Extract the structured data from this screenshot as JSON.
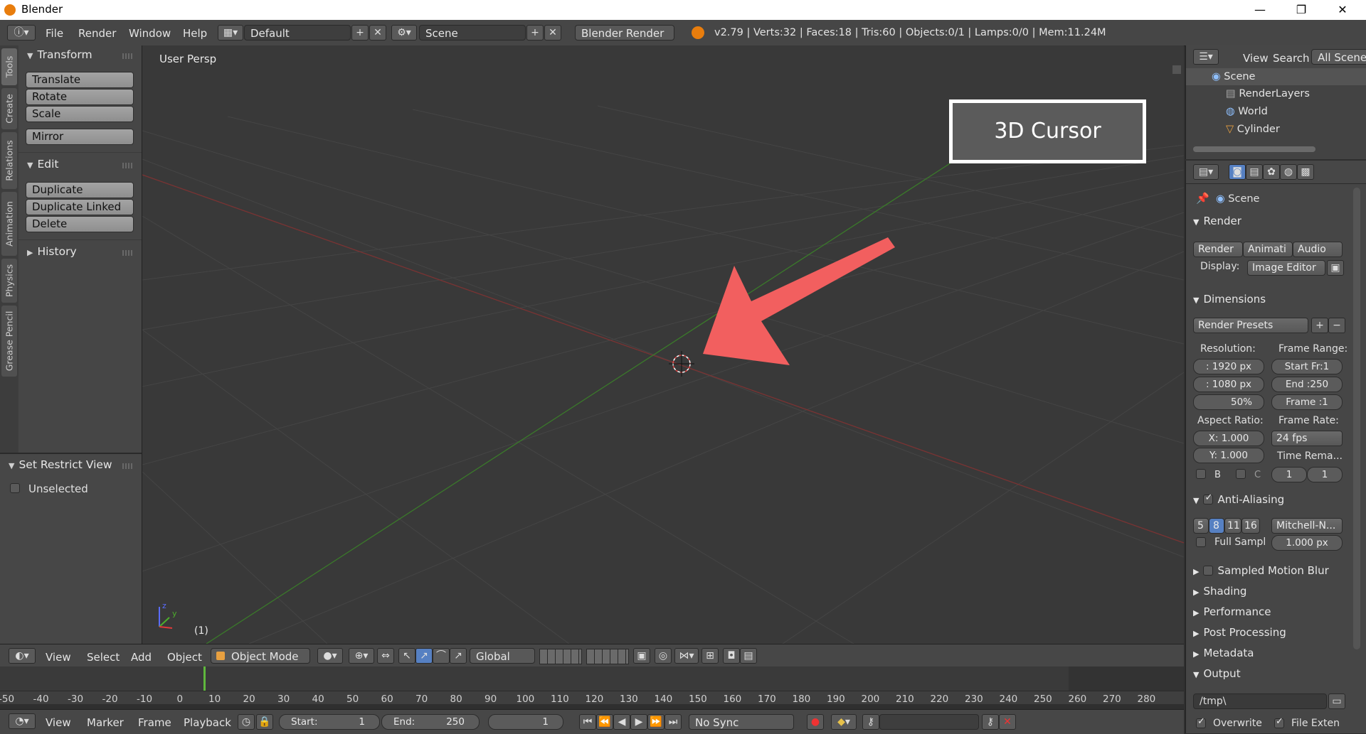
{
  "window": {
    "title": "Blender",
    "minimize": "—",
    "maximize": "❐",
    "close": "✕"
  },
  "topbar": {
    "menus": [
      "File",
      "Render",
      "Window",
      "Help"
    ],
    "layout": "Default",
    "scene": "Scene",
    "engine": "Blender Render",
    "stats": "v2.79 | Verts:32 | Faces:18 | Tris:60 | Objects:0/1 | Lamps:0/0 | Mem:11.24M"
  },
  "vtabs": [
    "Tools",
    "Create",
    "Relations",
    "Animation",
    "Physics",
    "Grease Pencil"
  ],
  "toolshelf": {
    "transform": {
      "title": "Transform",
      "buttons": [
        "Translate",
        "Rotate",
        "Scale",
        "Mirror"
      ]
    },
    "edit": {
      "title": "Edit",
      "buttons": [
        "Duplicate",
        "Duplicate Linked",
        "Delete"
      ]
    },
    "history": "History",
    "restrict": {
      "title": "Set Restrict View",
      "option": "Unselected"
    }
  },
  "viewport": {
    "label": "User Persp",
    "frame_indicator": "(1)",
    "callout": "3D Cursor",
    "axis_z": "z",
    "axis_y": "y"
  },
  "header3d": {
    "menus": [
      "View",
      "Select",
      "Add",
      "Object"
    ],
    "mode": "Object Mode",
    "orientation": "Global"
  },
  "timeline": {
    "ticks": [
      "-50",
      "-40",
      "-30",
      "-20",
      "-10",
      "0",
      "10",
      "20",
      "30",
      "40",
      "50",
      "60",
      "70",
      "80",
      "90",
      "100",
      "110",
      "120",
      "130",
      "140",
      "150",
      "160",
      "170",
      "180",
      "190",
      "200",
      "210",
      "220",
      "230",
      "240",
      "250",
      "260",
      "270",
      "280"
    ],
    "menus": [
      "View",
      "Marker",
      "Frame",
      "Playback"
    ],
    "start_label": "Start:",
    "start": "1",
    "end_label": "End:",
    "end": "250",
    "current": "1",
    "sync": "No Sync"
  },
  "outliner": {
    "menus": [
      "View",
      "Search"
    ],
    "filter": "All Scenes",
    "rows": [
      "Scene",
      "RenderLayers",
      "World",
      "Cylinder"
    ]
  },
  "properties": {
    "context": "Scene",
    "render": {
      "title": "Render",
      "buttons": [
        "Render",
        "Animati",
        "Audio"
      ],
      "display_label": "Display:",
      "display": "Image Editor"
    },
    "dimensions": {
      "title": "Dimensions",
      "presets": "Render Presets",
      "resolution_label": "Resolution:",
      "res_x": ": 1920 px",
      "res_y": ": 1080 px",
      "res_pct": "50%",
      "frame_range_label": "Frame Range:",
      "start": "Start Fr:1",
      "end": "End :250",
      "frame": "Frame :1",
      "aspect_label": "Aspect Ratio:",
      "asp_x": "X:  1.000",
      "asp_y": "Y:  1.000",
      "frame_rate_label": "Frame Rate:",
      "fps": "24 fps",
      "time_remap_label": "Time Rema...",
      "remap_old": "1",
      "remap_new": "1",
      "b_label": "B",
      "c_label": "C"
    },
    "anti_aliasing": {
      "title": "Anti-Aliasing",
      "samples": [
        "5",
        "8",
        "11",
        "16"
      ],
      "filter": "Mitchell-N...",
      "full_sample": "Full Sampl",
      "size": "1.000 px"
    },
    "collapsed": [
      "Sampled Motion Blur",
      "Shading",
      "Performance",
      "Post Processing",
      "Metadata"
    ],
    "output": {
      "title": "Output",
      "path": "/tmp\\",
      "overwrite": "Overwrite",
      "extension": "File Exten"
    }
  }
}
